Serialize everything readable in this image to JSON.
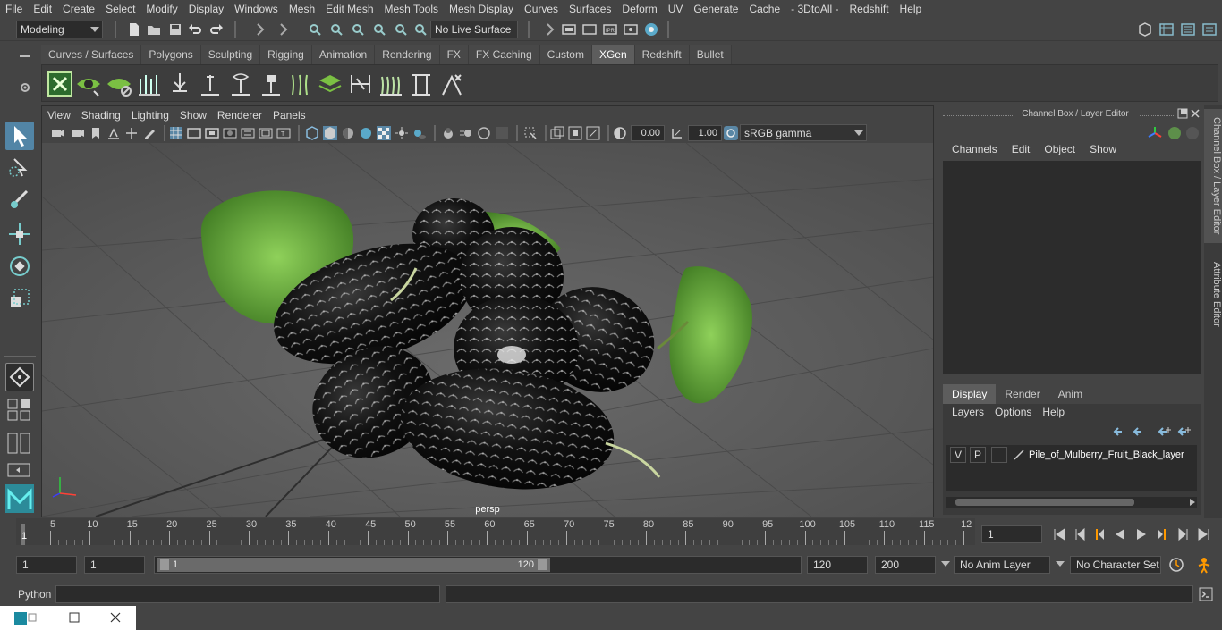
{
  "menubar": {
    "items": [
      "File",
      "Edit",
      "Create",
      "Select",
      "Modify",
      "Display",
      "Windows",
      "Mesh",
      "Edit Mesh",
      "Mesh Tools",
      "Mesh Display",
      "Curves",
      "Surfaces",
      "Deform",
      "UV",
      "Generate",
      "Cache",
      "- 3DtoAll -",
      "Redshift",
      "Help"
    ]
  },
  "status_line": {
    "mode": "Modeling",
    "live_surface": "No Live Surface"
  },
  "shelf": {
    "tabs": [
      "Curves / Surfaces",
      "Polygons",
      "Sculpting",
      "Rigging",
      "Animation",
      "Rendering",
      "FX",
      "FX Caching",
      "Custom",
      "XGen",
      "Redshift",
      "Bullet"
    ],
    "active_tab": "XGen"
  },
  "viewport": {
    "menu": [
      "View",
      "Shading",
      "Lighting",
      "Show",
      "Renderer",
      "Panels"
    ],
    "exposure": "0.00",
    "gamma": "1.00",
    "color_space": "sRGB gamma",
    "camera_label": "persp"
  },
  "channel_box": {
    "title": "Channel Box / Layer Editor",
    "menu": [
      "Channels",
      "Edit",
      "Object",
      "Show"
    ],
    "layer_tabs": [
      "Display",
      "Render",
      "Anim"
    ],
    "active_layer_tab": "Display",
    "layer_menu": [
      "Layers",
      "Options",
      "Help"
    ],
    "layer": {
      "v": "V",
      "p": "P",
      "name": "Pile_of_Mulberry_Fruit_Black_layer"
    }
  },
  "side_tabs": [
    "Channel Box / Layer Editor",
    "Attribute Editor"
  ],
  "timeline": {
    "ticks": [
      "5",
      "10",
      "15",
      "20",
      "25",
      "30",
      "35",
      "40",
      "45",
      "50",
      "55",
      "60",
      "65",
      "70",
      "75",
      "80",
      "85",
      "90",
      "95",
      "100",
      "105",
      "110",
      "115",
      "12"
    ],
    "start_label": "1",
    "current_frame": "1"
  },
  "range": {
    "start": "1",
    "start2": "1",
    "slider_start": "1",
    "slider_end": "120",
    "end": "120",
    "max": "200",
    "anim_layer": "No Anim Layer",
    "char_set": "No Character Set"
  },
  "cmdline": {
    "label": "Python"
  },
  "colors": {
    "accent_blue": "#5285a6",
    "active_tab": "#5d5d5d",
    "leaf_green": "#6fb23a"
  }
}
